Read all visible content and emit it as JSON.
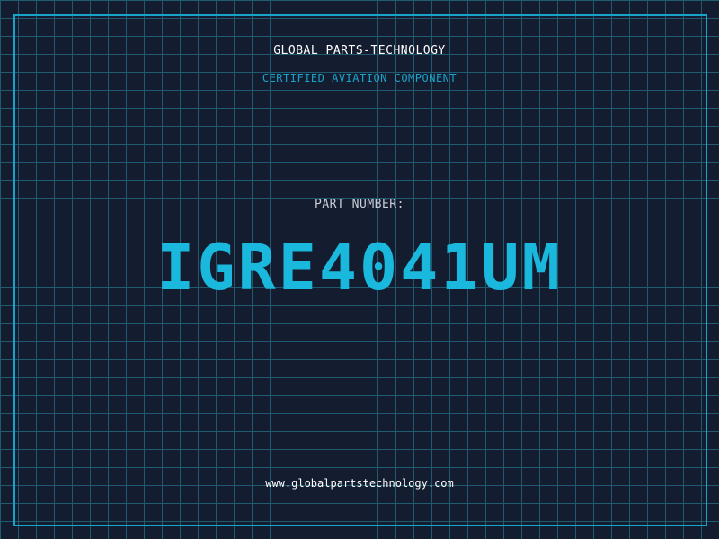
{
  "header": {
    "brand": "GLOBAL PARTS-TECHNOLOGY",
    "subtitle": "CERTIFIED AVIATION COMPONENT"
  },
  "main": {
    "label": "PART NUMBER:",
    "part_number": "IGRE4041UM"
  },
  "footer": {
    "url": "www.globalpartstechnology.com"
  },
  "colors": {
    "background": "#141c30",
    "grid": "#1f5a6e",
    "accent": "#1aa3c8",
    "text": "#ffffff"
  }
}
